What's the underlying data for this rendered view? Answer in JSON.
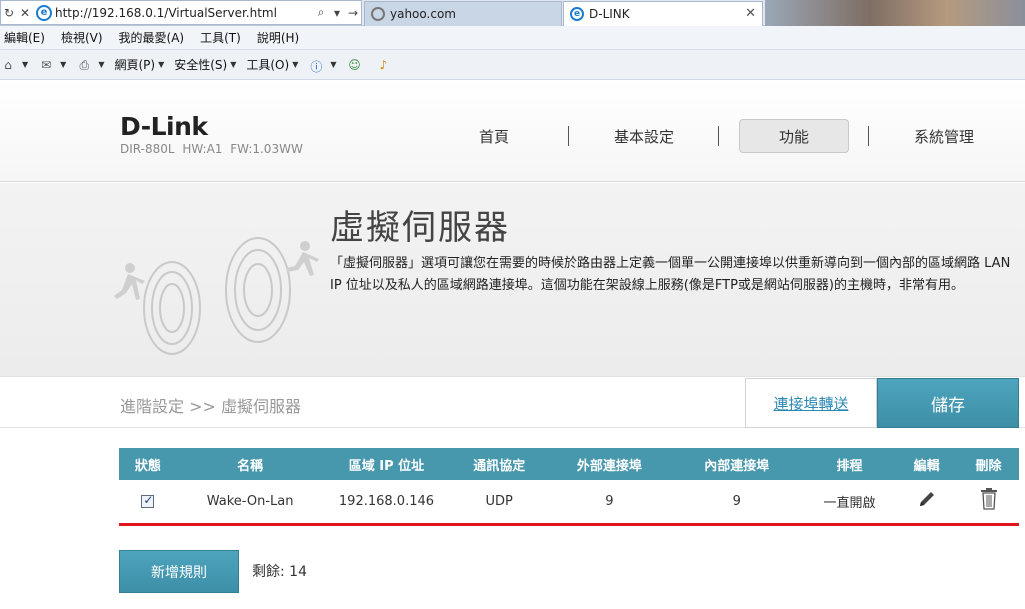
{
  "browser": {
    "address_url": "http://192.168.0.1/VirtualServer.html",
    "tabs": [
      {
        "label": "yahoo.com"
      },
      {
        "label": "D-LINK"
      }
    ],
    "menu": [
      "編輯(E)",
      "檢視(V)",
      "我的最愛(A)",
      "工具(T)",
      "說明(H)"
    ],
    "commands": [
      "網頁(P)",
      "安全性(S)",
      "工具(O)"
    ]
  },
  "header": {
    "logo": "D-Link",
    "model": "DIR-880L HW:A1 FW:1.03WW",
    "nav": [
      "首頁",
      "基本設定",
      "功能",
      "系統管理"
    ]
  },
  "banner": {
    "title": "虛擬伺服器",
    "description": "「虛擬伺服器」選項可讓您在需要的時候於路由器上定義一個單一公開連接埠以供重新導向到一個內部的區域網路 LAN IP 位址以及私人的區域網路連接埠。這個功能在架設線上服務(像是FTP或是網站伺服器)的主機時，非常有用。"
  },
  "breadcrumb": "進階設定 >> 虛擬伺服器",
  "port_forward_link": "連接埠轉送",
  "save_label": "儲存",
  "table": {
    "headers": [
      "狀態",
      "名稱",
      "區域 IP 位址",
      "通訊協定",
      "外部連接埠",
      "內部連接埠",
      "排程",
      "編輯",
      "刪除"
    ],
    "rows": [
      {
        "name": "Wake-On-Lan",
        "ip": "192.168.0.146",
        "protocol": "UDP",
        "external_port": "9",
        "internal_port": "9",
        "schedule": "一直開啟"
      }
    ]
  },
  "add_rule_label": "新增規則",
  "remaining_label": "剩餘: 14",
  "colors": {
    "accent": "#4797ad",
    "highlight": "#e2141d"
  }
}
